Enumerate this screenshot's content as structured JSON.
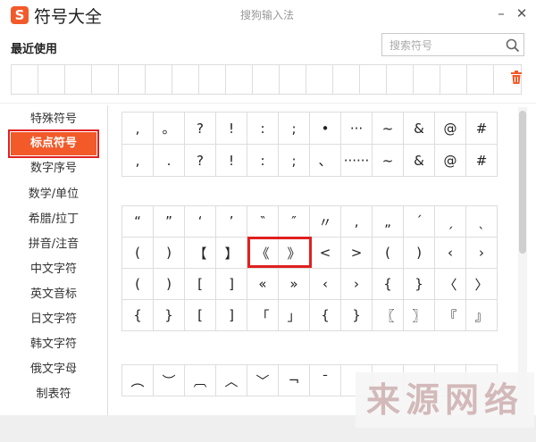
{
  "window": {
    "logo_letter": "S",
    "title": "符号大全",
    "ime_name": "搜狗输入法",
    "minimize_glyph": "–",
    "close_glyph": "✕"
  },
  "recent": {
    "label": "最近使用",
    "slots": 19
  },
  "search": {
    "placeholder": "搜索符号",
    "value": ""
  },
  "colors": {
    "accent": "#f25a2a",
    "highlight": "#e02020"
  },
  "sidebar": {
    "items": [
      {
        "label": "特殊符号",
        "active": false
      },
      {
        "label": "标点符号",
        "active": true
      },
      {
        "label": "数字序号",
        "active": false
      },
      {
        "label": "数学/单位",
        "active": false
      },
      {
        "label": "希腊/拉丁",
        "active": false
      },
      {
        "label": "拼音/注音",
        "active": false
      },
      {
        "label": "中文字符",
        "active": false
      },
      {
        "label": "英文音标",
        "active": false
      },
      {
        "label": "日文字符",
        "active": false
      },
      {
        "label": "韩文字符",
        "active": false
      },
      {
        "label": "俄文字母",
        "active": false
      },
      {
        "label": "制表符",
        "active": false
      }
    ]
  },
  "grid1": [
    ",",
    "。",
    "?",
    "!",
    ":",
    ";",
    "•",
    "···",
    "~",
    "&",
    "@",
    "#",
    ",",
    ".",
    "?",
    "!",
    ":",
    ";",
    "、",
    "······",
    "~",
    "&",
    "@",
    "#"
  ],
  "grid2": [
    "“",
    "”",
    "‘",
    "’",
    "‶",
    "″",
    "〃",
    "‚",
    "„",
    "ˊ",
    "ˏ",
    "ˎ",
    "(",
    ")",
    "【",
    "】",
    "《",
    "》",
    "<",
    ">",
    "(",
    ")",
    "‹",
    "›",
    "(",
    ")",
    "[",
    "]",
    "«",
    "»",
    "‹",
    "›",
    "{",
    "}",
    "〈",
    "〉",
    "{",
    "}",
    "[",
    "]",
    "「",
    "」",
    "{",
    "}",
    "〖",
    "〗",
    "『",
    "』"
  ],
  "grid3": [
    "︵",
    "︶",
    "︹",
    "︿",
    "﹀",
    "¬",
    "ˉ",
    "",
    "",
    "",
    "",
    ""
  ],
  "watermark": "来源网络"
}
